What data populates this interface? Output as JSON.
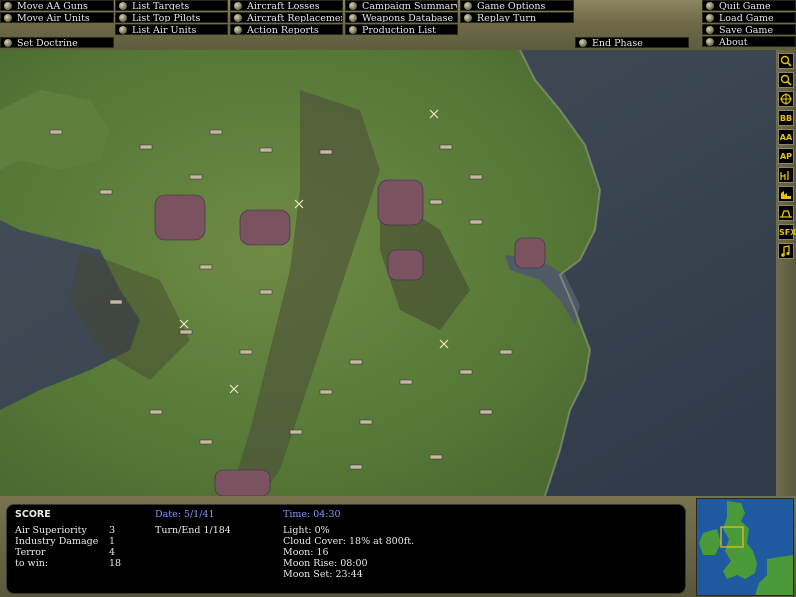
{
  "menu": {
    "move_aa_guns": "Move AA Guns",
    "move_air_units": "Move Air Units",
    "set_doctrine": "Set Doctrine",
    "list_targets": "List Targets",
    "list_top_pilots": "List Top Pilots",
    "list_air_units": "List Air Units",
    "aircraft_losses": "Aircraft Losses",
    "aircraft_replacements": "Aircraft Replacements",
    "action_reports": "Action Reports",
    "campaign_summary": "Campaign Summary",
    "weapons_database": "Weapons Database",
    "production_list": "Production List",
    "game_options": "Game Options",
    "replay_turn": "Replay Turn",
    "end_phase": "End Phase",
    "quit_game": "Quit Game",
    "load_game": "Load Game",
    "save_game": "Save Game",
    "about": "About"
  },
  "tools": {
    "bb": "BB",
    "aa": "AA",
    "ap": "AP",
    "sfx": "SFX"
  },
  "score": {
    "title": "SCORE",
    "rows": [
      {
        "label": "Air Superiority",
        "value": "3"
      },
      {
        "label": "Industry Damage",
        "value": "1"
      },
      {
        "label": "Terror",
        "value": "4"
      },
      {
        "label": "to win:",
        "value": "18"
      }
    ]
  },
  "status": {
    "date": "Date: 5/1/41",
    "turn": "Turn/End 1/184",
    "time": "Time: 04:30",
    "light": "Light: 0%",
    "cloud": "Cloud Cover: 18% at 800ft.",
    "moon": "Moon: 16",
    "moon_rise": "Moon Rise: 08:00",
    "moon_set": "Moon Set: 23:44"
  },
  "colors": {
    "button_text": "#e6e6e6",
    "tool_text": "#e6c400",
    "date_blue": "#8a92ff",
    "sea": "#3b4550",
    "land": "#5a7a3a"
  }
}
